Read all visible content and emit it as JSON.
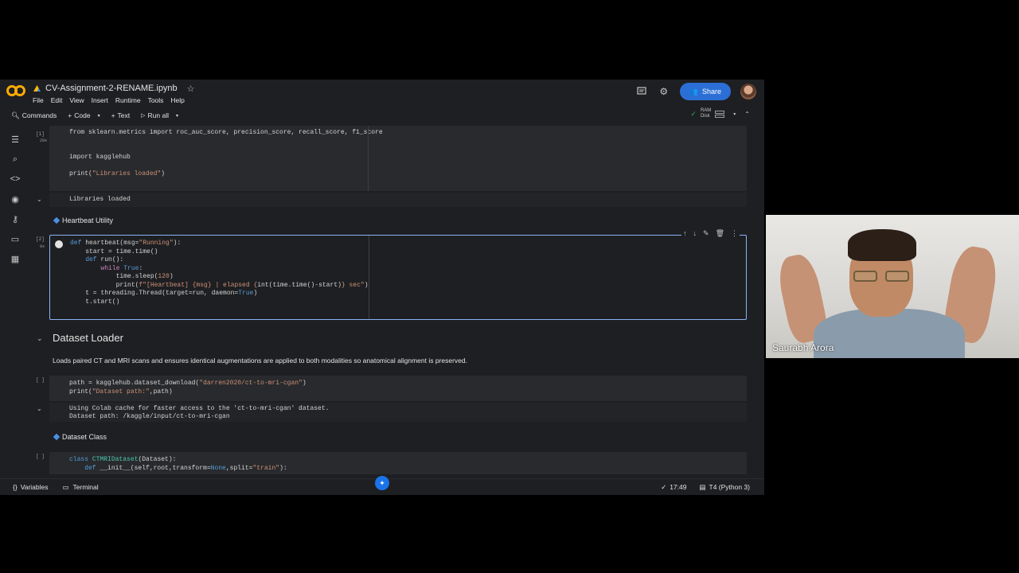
{
  "header": {
    "file_name": "CV-Assignment-2-RENAME.ipynb",
    "menu": [
      "File",
      "Edit",
      "View",
      "Insert",
      "Runtime",
      "Tools",
      "Help"
    ],
    "share_label": "Share"
  },
  "toolbar": {
    "commands_label": "Commands",
    "code_label": "Code",
    "text_label": "Text",
    "run_all_label": "Run all",
    "ram_label": "RAM",
    "disk_label": "Disk"
  },
  "cells": {
    "cell1": {
      "exec_count": "[1]",
      "exec_time": "29s",
      "line1": "from sklearn.metrics import roc_auc_score, precision_score, recall_score, f1_score",
      "line2": "import kagglehub",
      "line3_pre": "print(",
      "line3_str": "\"Libraries loaded\"",
      "line3_post": ")",
      "output": "Libraries loaded"
    },
    "heartbeat_heading": "Heartbeat Utility",
    "cell2": {
      "exec_count": "[2]",
      "exec_time": "0s"
    },
    "dataset_heading": "Dataset Loader",
    "dataset_desc": "Loads paired CT and MRI scans and ensures identical augmentations are applied to both modalities so anatomical alignment is preserved.",
    "cell3": {
      "exec_count": "[ ]",
      "output_line1": "Using Colab cache for faster access to the 'ct-to-mri-cgan' dataset.",
      "output_line2": "Dataset path: /kaggle/input/ct-to-mri-cgan"
    },
    "dataset_class_heading": "Dataset Class",
    "cell4": {
      "exec_count": "[ ]"
    }
  },
  "statusbar": {
    "variables_label": "Variables",
    "terminal_label": "Terminal",
    "time": "17:49",
    "runtime": "T4 (Python 3)"
  },
  "video": {
    "participant_name": "Saurabh Arora"
  },
  "colors": {
    "accent": "#2b6fd6",
    "keyword": "#569cd6",
    "string": "#ce9178"
  }
}
